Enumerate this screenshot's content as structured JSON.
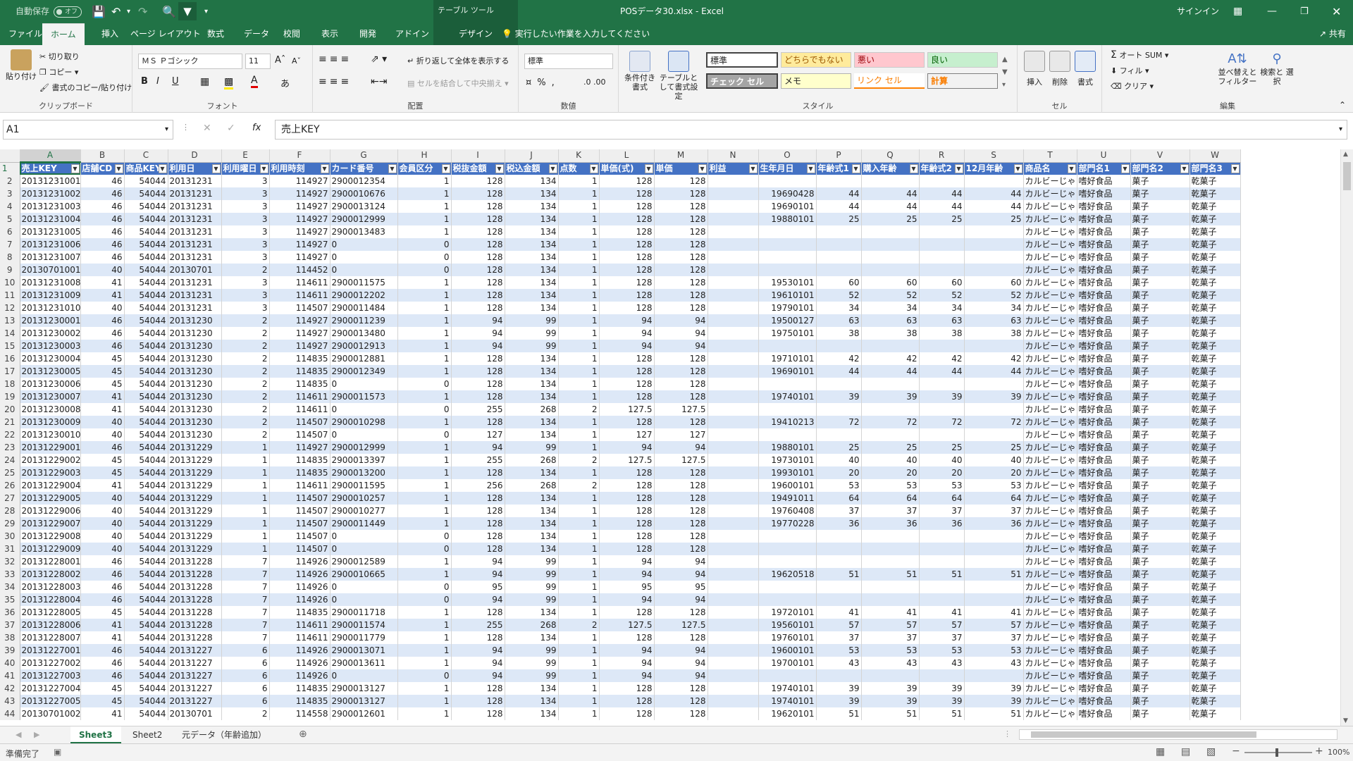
{
  "title": {
    "autosave": "自動保存",
    "autosave_state": "オフ",
    "table_tools": "テーブル ツール",
    "filename": "POSデータ30.xlsx - Excel",
    "signin": "サインイン",
    "share": "共有"
  },
  "tabs": [
    {
      "label": "ファイル"
    },
    {
      "label": "ホーム"
    },
    {
      "label": "挿入"
    },
    {
      "label": "ページ レイアウト"
    },
    {
      "label": "数式"
    },
    {
      "label": "データ"
    },
    {
      "label": "校閲"
    },
    {
      "label": "表示"
    },
    {
      "label": "開発"
    },
    {
      "label": "アドイン"
    },
    {
      "label": "デザイン"
    }
  ],
  "tellme": "実行したい作業を入力してください",
  "ribbon": {
    "clipboard": {
      "paste": "貼り付け",
      "cut": "切り取り",
      "copy": "コピー",
      "format_painter": "書式のコピー/貼り付け",
      "label": "クリップボード"
    },
    "font": {
      "name": "ＭＳ Ｐゴシック",
      "size": "11",
      "bold": "B",
      "italic": "I",
      "underline": "U",
      "label": "フォント"
    },
    "alignment": {
      "wrap": "折り返して全体を表示する",
      "merge": "セルを結合して中央揃え",
      "label": "配置"
    },
    "number": {
      "format": "標準",
      "label": "数値"
    },
    "styles": {
      "conditional": "条件付き書式",
      "as_table": "テーブルとして書式設定",
      "cells": [
        "標準",
        "どちらでもない",
        "悪い",
        "良い",
        "チェック セル",
        "メモ",
        "リンク セル",
        "計算"
      ],
      "label": "スタイル"
    },
    "cells": {
      "insert": "挿入",
      "delete": "削除",
      "format": "書式",
      "label": "セル"
    },
    "editing": {
      "autosum": "オート SUM",
      "fill": "フィル",
      "clear": "クリア",
      "sort": "並べ替えと フィルター",
      "find": "検索と 選択",
      "label": "編集"
    }
  },
  "formula": {
    "namebox": "A1",
    "fx": "fx",
    "value": "売上KEY"
  },
  "columns": [
    "A",
    "B",
    "C",
    "D",
    "E",
    "F",
    "G",
    "H",
    "I",
    "J",
    "K",
    "L",
    "M",
    "N",
    "O",
    "P",
    "Q",
    "R",
    "S",
    "T",
    "U",
    "V",
    "W"
  ],
  "headers": [
    "売上KEY",
    "店舗CD",
    "商品KEY",
    "利用日",
    "利用曜日",
    "利用時刻",
    "カード番号",
    "会員区分",
    "税抜金額",
    "税込金額",
    "点数",
    "単価(式)",
    "単価",
    "利益",
    "生年月日",
    "年齢式1",
    "購入年齢",
    "年齢式2",
    "12月年齢",
    "商品名",
    "部門名1",
    "部門名2",
    "部門名3"
  ],
  "rows": [
    [
      "20131231001",
      "46",
      "54044",
      "20131231",
      "3",
      "114927",
      "2900012354",
      "1",
      "128",
      "134",
      "1",
      "128",
      "128",
      "",
      "",
      "",
      "",
      "",
      "",
      "カルビーじゃ",
      "嗜好食品",
      "菓子",
      "乾菓子"
    ],
    [
      "20131231002",
      "46",
      "54044",
      "20131231",
      "3",
      "114927",
      "2900010676",
      "1",
      "128",
      "134",
      "1",
      "128",
      "128",
      "",
      "19690428",
      "44",
      "44",
      "44",
      "44",
      "カルビーじゃ",
      "嗜好食品",
      "菓子",
      "乾菓子"
    ],
    [
      "20131231003",
      "46",
      "54044",
      "20131231",
      "3",
      "114927",
      "2900013124",
      "1",
      "128",
      "134",
      "1",
      "128",
      "128",
      "",
      "19690101",
      "44",
      "44",
      "44",
      "44",
      "カルビーじゃ",
      "嗜好食品",
      "菓子",
      "乾菓子"
    ],
    [
      "20131231004",
      "46",
      "54044",
      "20131231",
      "3",
      "114927",
      "2900012999",
      "1",
      "128",
      "134",
      "1",
      "128",
      "128",
      "",
      "19880101",
      "25",
      "25",
      "25",
      "25",
      "カルビーじゃ",
      "嗜好食品",
      "菓子",
      "乾菓子"
    ],
    [
      "20131231005",
      "46",
      "54044",
      "20131231",
      "3",
      "114927",
      "2900013483",
      "1",
      "128",
      "134",
      "1",
      "128",
      "128",
      "",
      "",
      "",
      "",
      "",
      "",
      "カルビーじゃ",
      "嗜好食品",
      "菓子",
      "乾菓子"
    ],
    [
      "20131231006",
      "46",
      "54044",
      "20131231",
      "3",
      "114927",
      "0",
      "0",
      "128",
      "134",
      "1",
      "128",
      "128",
      "",
      "",
      "",
      "",
      "",
      "",
      "カルビーじゃ",
      "嗜好食品",
      "菓子",
      "乾菓子"
    ],
    [
      "20131231007",
      "46",
      "54044",
      "20131231",
      "3",
      "114927",
      "0",
      "0",
      "128",
      "134",
      "1",
      "128",
      "128",
      "",
      "",
      "",
      "",
      "",
      "",
      "カルビーじゃ",
      "嗜好食品",
      "菓子",
      "乾菓子"
    ],
    [
      "20130701001",
      "40",
      "54044",
      "20130701",
      "2",
      "114452",
      "0",
      "0",
      "128",
      "134",
      "1",
      "128",
      "128",
      "",
      "",
      "",
      "",
      "",
      "",
      "カルビーじゃ",
      "嗜好食品",
      "菓子",
      "乾菓子"
    ],
    [
      "20131231008",
      "41",
      "54044",
      "20131231",
      "3",
      "114611",
      "2900011575",
      "1",
      "128",
      "134",
      "1",
      "128",
      "128",
      "",
      "19530101",
      "60",
      "60",
      "60",
      "60",
      "カルビーじゃ",
      "嗜好食品",
      "菓子",
      "乾菓子"
    ],
    [
      "20131231009",
      "41",
      "54044",
      "20131231",
      "3",
      "114611",
      "2900012202",
      "1",
      "128",
      "134",
      "1",
      "128",
      "128",
      "",
      "19610101",
      "52",
      "52",
      "52",
      "52",
      "カルビーじゃ",
      "嗜好食品",
      "菓子",
      "乾菓子"
    ],
    [
      "20131231010",
      "40",
      "54044",
      "20131231",
      "3",
      "114507",
      "2900011484",
      "1",
      "128",
      "134",
      "1",
      "128",
      "128",
      "",
      "19790101",
      "34",
      "34",
      "34",
      "34",
      "カルビーじゃ",
      "嗜好食品",
      "菓子",
      "乾菓子"
    ],
    [
      "20131230001",
      "46",
      "54044",
      "20131230",
      "2",
      "114927",
      "2900011239",
      "1",
      "94",
      "99",
      "1",
      "94",
      "94",
      "",
      "19500127",
      "63",
      "63",
      "63",
      "63",
      "カルビーじゃ",
      "嗜好食品",
      "菓子",
      "乾菓子"
    ],
    [
      "20131230002",
      "46",
      "54044",
      "20131230",
      "2",
      "114927",
      "2900013480",
      "1",
      "94",
      "99",
      "1",
      "94",
      "94",
      "",
      "19750101",
      "38",
      "38",
      "38",
      "38",
      "カルビーじゃ",
      "嗜好食品",
      "菓子",
      "乾菓子"
    ],
    [
      "20131230003",
      "46",
      "54044",
      "20131230",
      "2",
      "114927",
      "2900012913",
      "1",
      "94",
      "99",
      "1",
      "94",
      "94",
      "",
      "",
      "",
      "",
      "",
      "",
      "カルビーじゃ",
      "嗜好食品",
      "菓子",
      "乾菓子"
    ],
    [
      "20131230004",
      "45",
      "54044",
      "20131230",
      "2",
      "114835",
      "2900012881",
      "1",
      "128",
      "134",
      "1",
      "128",
      "128",
      "",
      "19710101",
      "42",
      "42",
      "42",
      "42",
      "カルビーじゃ",
      "嗜好食品",
      "菓子",
      "乾菓子"
    ],
    [
      "20131230005",
      "45",
      "54044",
      "20131230",
      "2",
      "114835",
      "2900012349",
      "1",
      "128",
      "134",
      "1",
      "128",
      "128",
      "",
      "19690101",
      "44",
      "44",
      "44",
      "44",
      "カルビーじゃ",
      "嗜好食品",
      "菓子",
      "乾菓子"
    ],
    [
      "20131230006",
      "45",
      "54044",
      "20131230",
      "2",
      "114835",
      "0",
      "0",
      "128",
      "134",
      "1",
      "128",
      "128",
      "",
      "",
      "",
      "",
      "",
      "",
      "カルビーじゃ",
      "嗜好食品",
      "菓子",
      "乾菓子"
    ],
    [
      "20131230007",
      "41",
      "54044",
      "20131230",
      "2",
      "114611",
      "2900011573",
      "1",
      "128",
      "134",
      "1",
      "128",
      "128",
      "",
      "19740101",
      "39",
      "39",
      "39",
      "39",
      "カルビーじゃ",
      "嗜好食品",
      "菓子",
      "乾菓子"
    ],
    [
      "20131230008",
      "41",
      "54044",
      "20131230",
      "2",
      "114611",
      "0",
      "0",
      "255",
      "268",
      "2",
      "127.5",
      "127.5",
      "",
      "",
      "",
      "",
      "",
      "",
      "カルビーじゃ",
      "嗜好食品",
      "菓子",
      "乾菓子"
    ],
    [
      "20131230009",
      "40",
      "54044",
      "20131230",
      "2",
      "114507",
      "2900010298",
      "1",
      "128",
      "134",
      "1",
      "128",
      "128",
      "",
      "19410213",
      "72",
      "72",
      "72",
      "72",
      "カルビーじゃ",
      "嗜好食品",
      "菓子",
      "乾菓子"
    ],
    [
      "20131230010",
      "40",
      "54044",
      "20131230",
      "2",
      "114507",
      "0",
      "0",
      "127",
      "134",
      "1",
      "127",
      "127",
      "",
      "",
      "",
      "",
      "",
      "",
      "カルビーじゃ",
      "嗜好食品",
      "菓子",
      "乾菓子"
    ],
    [
      "20131229001",
      "46",
      "54044",
      "20131229",
      "1",
      "114927",
      "2900012999",
      "1",
      "94",
      "99",
      "1",
      "94",
      "94",
      "",
      "19880101",
      "25",
      "25",
      "25",
      "25",
      "カルビーじゃ",
      "嗜好食品",
      "菓子",
      "乾菓子"
    ],
    [
      "20131229002",
      "45",
      "54044",
      "20131229",
      "1",
      "114835",
      "2900013397",
      "1",
      "255",
      "268",
      "2",
      "127.5",
      "127.5",
      "",
      "19730101",
      "40",
      "40",
      "40",
      "40",
      "カルビーじゃ",
      "嗜好食品",
      "菓子",
      "乾菓子"
    ],
    [
      "20131229003",
      "45",
      "54044",
      "20131229",
      "1",
      "114835",
      "2900013200",
      "1",
      "128",
      "134",
      "1",
      "128",
      "128",
      "",
      "19930101",
      "20",
      "20",
      "20",
      "20",
      "カルビーじゃ",
      "嗜好食品",
      "菓子",
      "乾菓子"
    ],
    [
      "20131229004",
      "41",
      "54044",
      "20131229",
      "1",
      "114611",
      "2900011595",
      "1",
      "256",
      "268",
      "2",
      "128",
      "128",
      "",
      "19600101",
      "53",
      "53",
      "53",
      "53",
      "カルビーじゃ",
      "嗜好食品",
      "菓子",
      "乾菓子"
    ],
    [
      "20131229005",
      "40",
      "54044",
      "20131229",
      "1",
      "114507",
      "2900010257",
      "1",
      "128",
      "134",
      "1",
      "128",
      "128",
      "",
      "19491011",
      "64",
      "64",
      "64",
      "64",
      "カルビーじゃ",
      "嗜好食品",
      "菓子",
      "乾菓子"
    ],
    [
      "20131229006",
      "40",
      "54044",
      "20131229",
      "1",
      "114507",
      "2900010277",
      "1",
      "128",
      "134",
      "1",
      "128",
      "128",
      "",
      "19760408",
      "37",
      "37",
      "37",
      "37",
      "カルビーじゃ",
      "嗜好食品",
      "菓子",
      "乾菓子"
    ],
    [
      "20131229007",
      "40",
      "54044",
      "20131229",
      "1",
      "114507",
      "2900011449",
      "1",
      "128",
      "134",
      "1",
      "128",
      "128",
      "",
      "19770228",
      "36",
      "36",
      "36",
      "36",
      "カルビーじゃ",
      "嗜好食品",
      "菓子",
      "乾菓子"
    ],
    [
      "20131229008",
      "40",
      "54044",
      "20131229",
      "1",
      "114507",
      "0",
      "0",
      "128",
      "134",
      "1",
      "128",
      "128",
      "",
      "",
      "",
      "",
      "",
      "",
      "カルビーじゃ",
      "嗜好食品",
      "菓子",
      "乾菓子"
    ],
    [
      "20131229009",
      "40",
      "54044",
      "20131229",
      "1",
      "114507",
      "0",
      "0",
      "128",
      "134",
      "1",
      "128",
      "128",
      "",
      "",
      "",
      "",
      "",
      "",
      "カルビーじゃ",
      "嗜好食品",
      "菓子",
      "乾菓子"
    ],
    [
      "20131228001",
      "46",
      "54044",
      "20131228",
      "7",
      "114926",
      "2900012589",
      "1",
      "94",
      "99",
      "1",
      "94",
      "94",
      "",
      "",
      "",
      "",
      "",
      "",
      "カルビーじゃ",
      "嗜好食品",
      "菓子",
      "乾菓子"
    ],
    [
      "20131228002",
      "46",
      "54044",
      "20131228",
      "7",
      "114926",
      "2900010665",
      "1",
      "94",
      "99",
      "1",
      "94",
      "94",
      "",
      "19620518",
      "51",
      "51",
      "51",
      "51",
      "カルビーじゃ",
      "嗜好食品",
      "菓子",
      "乾菓子"
    ],
    [
      "20131228003",
      "46",
      "54044",
      "20131228",
      "7",
      "114926",
      "0",
      "0",
      "95",
      "99",
      "1",
      "95",
      "95",
      "",
      "",
      "",
      "",
      "",
      "",
      "カルビーじゃ",
      "嗜好食品",
      "菓子",
      "乾菓子"
    ],
    [
      "20131228004",
      "46",
      "54044",
      "20131228",
      "7",
      "114926",
      "0",
      "0",
      "94",
      "99",
      "1",
      "94",
      "94",
      "",
      "",
      "",
      "",
      "",
      "",
      "カルビーじゃ",
      "嗜好食品",
      "菓子",
      "乾菓子"
    ],
    [
      "20131228005",
      "45",
      "54044",
      "20131228",
      "7",
      "114835",
      "2900011718",
      "1",
      "128",
      "134",
      "1",
      "128",
      "128",
      "",
      "19720101",
      "41",
      "41",
      "41",
      "41",
      "カルビーじゃ",
      "嗜好食品",
      "菓子",
      "乾菓子"
    ],
    [
      "20131228006",
      "41",
      "54044",
      "20131228",
      "7",
      "114611",
      "2900011574",
      "1",
      "255",
      "268",
      "2",
      "127.5",
      "127.5",
      "",
      "19560101",
      "57",
      "57",
      "57",
      "57",
      "カルビーじゃ",
      "嗜好食品",
      "菓子",
      "乾菓子"
    ],
    [
      "20131228007",
      "41",
      "54044",
      "20131228",
      "7",
      "114611",
      "2900011779",
      "1",
      "128",
      "134",
      "1",
      "128",
      "128",
      "",
      "19760101",
      "37",
      "37",
      "37",
      "37",
      "カルビーじゃ",
      "嗜好食品",
      "菓子",
      "乾菓子"
    ],
    [
      "20131227001",
      "46",
      "54044",
      "20131227",
      "6",
      "114926",
      "2900013071",
      "1",
      "94",
      "99",
      "1",
      "94",
      "94",
      "",
      "19600101",
      "53",
      "53",
      "53",
      "53",
      "カルビーじゃ",
      "嗜好食品",
      "菓子",
      "乾菓子"
    ],
    [
      "20131227002",
      "46",
      "54044",
      "20131227",
      "6",
      "114926",
      "2900013611",
      "1",
      "94",
      "99",
      "1",
      "94",
      "94",
      "",
      "19700101",
      "43",
      "43",
      "43",
      "43",
      "カルビーじゃ",
      "嗜好食品",
      "菓子",
      "乾菓子"
    ],
    [
      "20131227003",
      "46",
      "54044",
      "20131227",
      "6",
      "114926",
      "0",
      "0",
      "94",
      "99",
      "1",
      "94",
      "94",
      "",
      "",
      "",
      "",
      "",
      "",
      "カルビーじゃ",
      "嗜好食品",
      "菓子",
      "乾菓子"
    ],
    [
      "20131227004",
      "45",
      "54044",
      "20131227",
      "6",
      "114835",
      "2900013127",
      "1",
      "128",
      "134",
      "1",
      "128",
      "128",
      "",
      "19740101",
      "39",
      "39",
      "39",
      "39",
      "カルビーじゃ",
      "嗜好食品",
      "菓子",
      "乾菓子"
    ],
    [
      "20131227005",
      "45",
      "54044",
      "20131227",
      "6",
      "114835",
      "2900013127",
      "1",
      "128",
      "134",
      "1",
      "128",
      "128",
      "",
      "19740101",
      "39",
      "39",
      "39",
      "39",
      "カルビーじゃ",
      "嗜好食品",
      "菓子",
      "乾菓子"
    ],
    [
      "20130701002",
      "41",
      "54044",
      "20130701",
      "2",
      "114558",
      "2900012601",
      "1",
      "128",
      "134",
      "1",
      "128",
      "128",
      "",
      "19620101",
      "51",
      "51",
      "51",
      "51",
      "カルビーじゃ",
      "嗜好食品",
      "菓子",
      "乾菓子"
    ]
  ],
  "sheets": [
    "Sheet3",
    "Sheet2",
    "元データ（年齢追加）"
  ],
  "status": {
    "ready": "準備完了",
    "zoom": "100%"
  }
}
